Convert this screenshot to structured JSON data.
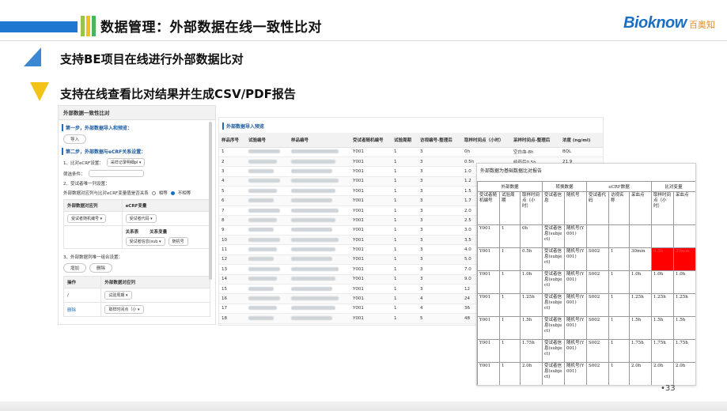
{
  "header": {
    "title": "数据管理：外部数据在线一致性比对",
    "logo_en": "Bioknow",
    "logo_cn": "百奥知"
  },
  "bullets": [
    "支持BE项目在线进行外部数据比对",
    "支持在线查看比对结果并生成CSV/PDF报告"
  ],
  "left_panel": {
    "title": "外部数据一致性比对",
    "step1": "第一步，外部数据导入和预览：",
    "import_btn": "导入",
    "step2": "第二步，外部数据与eCRF关系设置：",
    "row1_label": "1、比对eCRF设置：",
    "row1_value": "采样记录明细pl",
    "filter_label": "筛选条件：",
    "row2_label": "2、受试者唯一列设置：",
    "row2_question": "外部数据对应列与比对eCRF变量值是否关系",
    "radio_yes": "相等",
    "radio_no": "不相等",
    "map_headers": [
      "外部数据对应列",
      "eCRF变量"
    ],
    "map_row": [
      "受试者随机编号",
      "受试者代码"
    ],
    "sub_headers": [
      "关系表",
      "关系变量"
    ],
    "sub_row": [
      "受试者信息(sub",
      "随机号"
    ],
    "step3": "3、外部数据列唯一组合设置：",
    "add_btn": "增加",
    "del_btn": "删除",
    "op_headers": [
      "操作",
      "外部数据对应列"
    ],
    "op_rows": [
      [
        "/",
        "试验周期"
      ],
      [
        "删除",
        "取样时间点（小"
      ]
    ]
  },
  "grid": {
    "title": "外部数据导入预览",
    "columns": [
      "样品序号",
      "试验编号",
      "样品编号",
      "受试者随机编号",
      "试验周期",
      "访视编号-整理后",
      "取样时间点（小时）",
      "采样时间点-整理后",
      "浓度 (ng/ml)"
    ],
    "rows": [
      [
        "1",
        "",
        "",
        "Y001",
        "1",
        "3",
        "0h",
        "空白血-8h",
        "BQL"
      ],
      [
        "2",
        "",
        "",
        "Y001",
        "1",
        "3",
        "0.5h",
        "给药后0.5h",
        "21.9"
      ],
      [
        "3",
        "",
        "",
        "Y001",
        "1",
        "3",
        "1.0",
        "",
        ""
      ],
      [
        "4",
        "",
        "",
        "Y001",
        "1",
        "3",
        "1.2",
        "",
        ""
      ],
      [
        "5",
        "",
        "",
        "Y001",
        "1",
        "3",
        "1.5",
        "",
        ""
      ],
      [
        "6",
        "",
        "",
        "Y001",
        "1",
        "3",
        "1.7",
        "",
        ""
      ],
      [
        "7",
        "",
        "",
        "Y001",
        "1",
        "3",
        "2.0",
        "",
        ""
      ],
      [
        "8",
        "",
        "",
        "Y001",
        "1",
        "3",
        "2.5",
        "",
        ""
      ],
      [
        "9",
        "",
        "",
        "Y001",
        "1",
        "3",
        "3.0",
        "",
        ""
      ],
      [
        "10",
        "",
        "",
        "Y001",
        "1",
        "3",
        "3.5",
        "",
        ""
      ],
      [
        "11",
        "",
        "",
        "Y001",
        "1",
        "3",
        "4.0",
        "",
        ""
      ],
      [
        "12",
        "",
        "",
        "Y001",
        "1",
        "3",
        "5.0",
        "",
        ""
      ],
      [
        "13",
        "",
        "",
        "Y001",
        "1",
        "3",
        "7.0",
        "",
        ""
      ],
      [
        "14",
        "",
        "",
        "Y001",
        "1",
        "3",
        "9.0",
        "",
        ""
      ],
      [
        "15",
        "",
        "",
        "Y001",
        "1",
        "3",
        "12",
        "",
        ""
      ],
      [
        "16",
        "",
        "",
        "Y001",
        "1",
        "4",
        "24",
        "",
        ""
      ],
      [
        "17",
        "",
        "",
        "Y001",
        "1",
        "4",
        "36",
        "",
        ""
      ],
      [
        "18",
        "",
        "",
        "Y001",
        "1",
        "5",
        "48",
        "",
        ""
      ]
    ]
  },
  "report": {
    "title": "外部数据为基础数据比对报告",
    "groups": [
      "外部数据",
      "转换数据",
      "eCRF数据",
      "比对变量"
    ],
    "columns": [
      "受试者随机编号",
      "试验周期",
      "取样时间点（小时）",
      "受试者信息",
      "随机号",
      "受试者代码",
      "访视名称",
      "采血点",
      "取样时间点（小时）",
      "采血点"
    ],
    "rows": [
      [
        "Y001",
        "1",
        "0h",
        "受试者信息(subject)",
        "随机号(Y001)",
        "",
        "",
        "",
        "",
        ""
      ],
      [
        "Y001",
        "1",
        "0.5h",
        "受试者信息(subject)",
        "随机号(Y001)",
        "S002",
        "1",
        "30min",
        "0.5h",
        "30min"
      ],
      [
        "Y001",
        "1",
        "1.0h",
        "受试者信息(subject)",
        "随机号(Y001)",
        "S002",
        "1",
        "1.0h",
        "1.0h",
        "1.0h"
      ],
      [
        "Y001",
        "1",
        "1.25h",
        "受试者信息(subject)",
        "随机号(Y001)",
        "S002",
        "1",
        "1.25h",
        "1.25h",
        "1.25h"
      ],
      [
        "Y001",
        "1",
        "1.5h",
        "受试者信息(subject)",
        "随机号(Y001)",
        "S002",
        "1",
        "1.5h",
        "1.5h",
        "1.5h"
      ],
      [
        "Y001",
        "1",
        "1.75h",
        "受试者信息(subject)",
        "随机号(Y001)",
        "S002",
        "1",
        "1.75h",
        "1.75h",
        "1.75h"
      ],
      [
        "Y001",
        "1",
        "2.0h",
        "受试者信息(subject)",
        "随机号(Y001)",
        "S002",
        "1",
        "2.0h",
        "2.0h",
        "2.0h"
      ]
    ],
    "highlight_color": "#ff0000"
  },
  "page_number": "•33"
}
